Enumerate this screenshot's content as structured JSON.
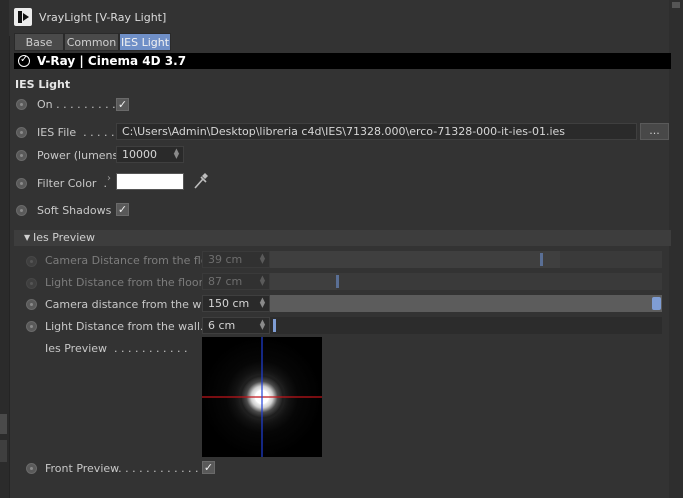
{
  "window": {
    "title": "VrayLight [V-Ray Light]"
  },
  "tabs": [
    {
      "label": "Base",
      "active": false
    },
    {
      "label": "Common",
      "active": false
    },
    {
      "label": "IES Light",
      "active": true
    }
  ],
  "header": {
    "text": "V-Ray | Cinema 4D   3.7"
  },
  "section_title": "IES Light",
  "params": {
    "on": {
      "label": "On . . . . . . . . .",
      "checked": true
    },
    "ies_file": {
      "label": "IES File  . . . . .",
      "value": "C:\\Users\\Admin\\Desktop\\libreria c4d\\IES\\71328.000\\erco-71328-000-it-ies-01.ies",
      "browse_label": "..."
    },
    "power": {
      "label": "Power (lumens)",
      "value": "10000"
    },
    "filter_color": {
      "label": "Filter Color  .",
      "color": "#ffffff"
    },
    "soft_shadows": {
      "label": "Soft Shadows",
      "checked": true
    }
  },
  "ies_preview_group": {
    "title": "Ies Preview",
    "camera_floor": {
      "label": "Camera Distance from the floor",
      "value": "39 cm",
      "slider_fraction": 0.74,
      "enabled": false
    },
    "light_floor": {
      "label": "Light Distance from the floor .",
      "value": "87 cm",
      "slider_fraction": 0.17,
      "enabled": false
    },
    "camera_wall": {
      "label": "Camera distance from the wall",
      "value": "150 cm",
      "slider_fraction": 1.0,
      "enabled": true
    },
    "light_wall": {
      "label": "Light Distance from the wall. .",
      "value": "6 cm",
      "slider_fraction": 0.0,
      "enabled": true
    },
    "preview": {
      "label": "Ies Preview  . . . . . . . . . . ."
    },
    "front_preview": {
      "label": "Front Preview. . . . . . . . . . . .",
      "checked": true
    }
  },
  "icons": {
    "app": "vraylight-icon",
    "header": "vray-logo-icon",
    "eyedropper": "eyedropper-icon",
    "expand": "triangle-down-icon",
    "color_arrow": "chevron-right-icon"
  },
  "colors": {
    "background": "#333333",
    "active_tab": "#6f8fc7",
    "slider_knob": "#7f9dd4"
  }
}
